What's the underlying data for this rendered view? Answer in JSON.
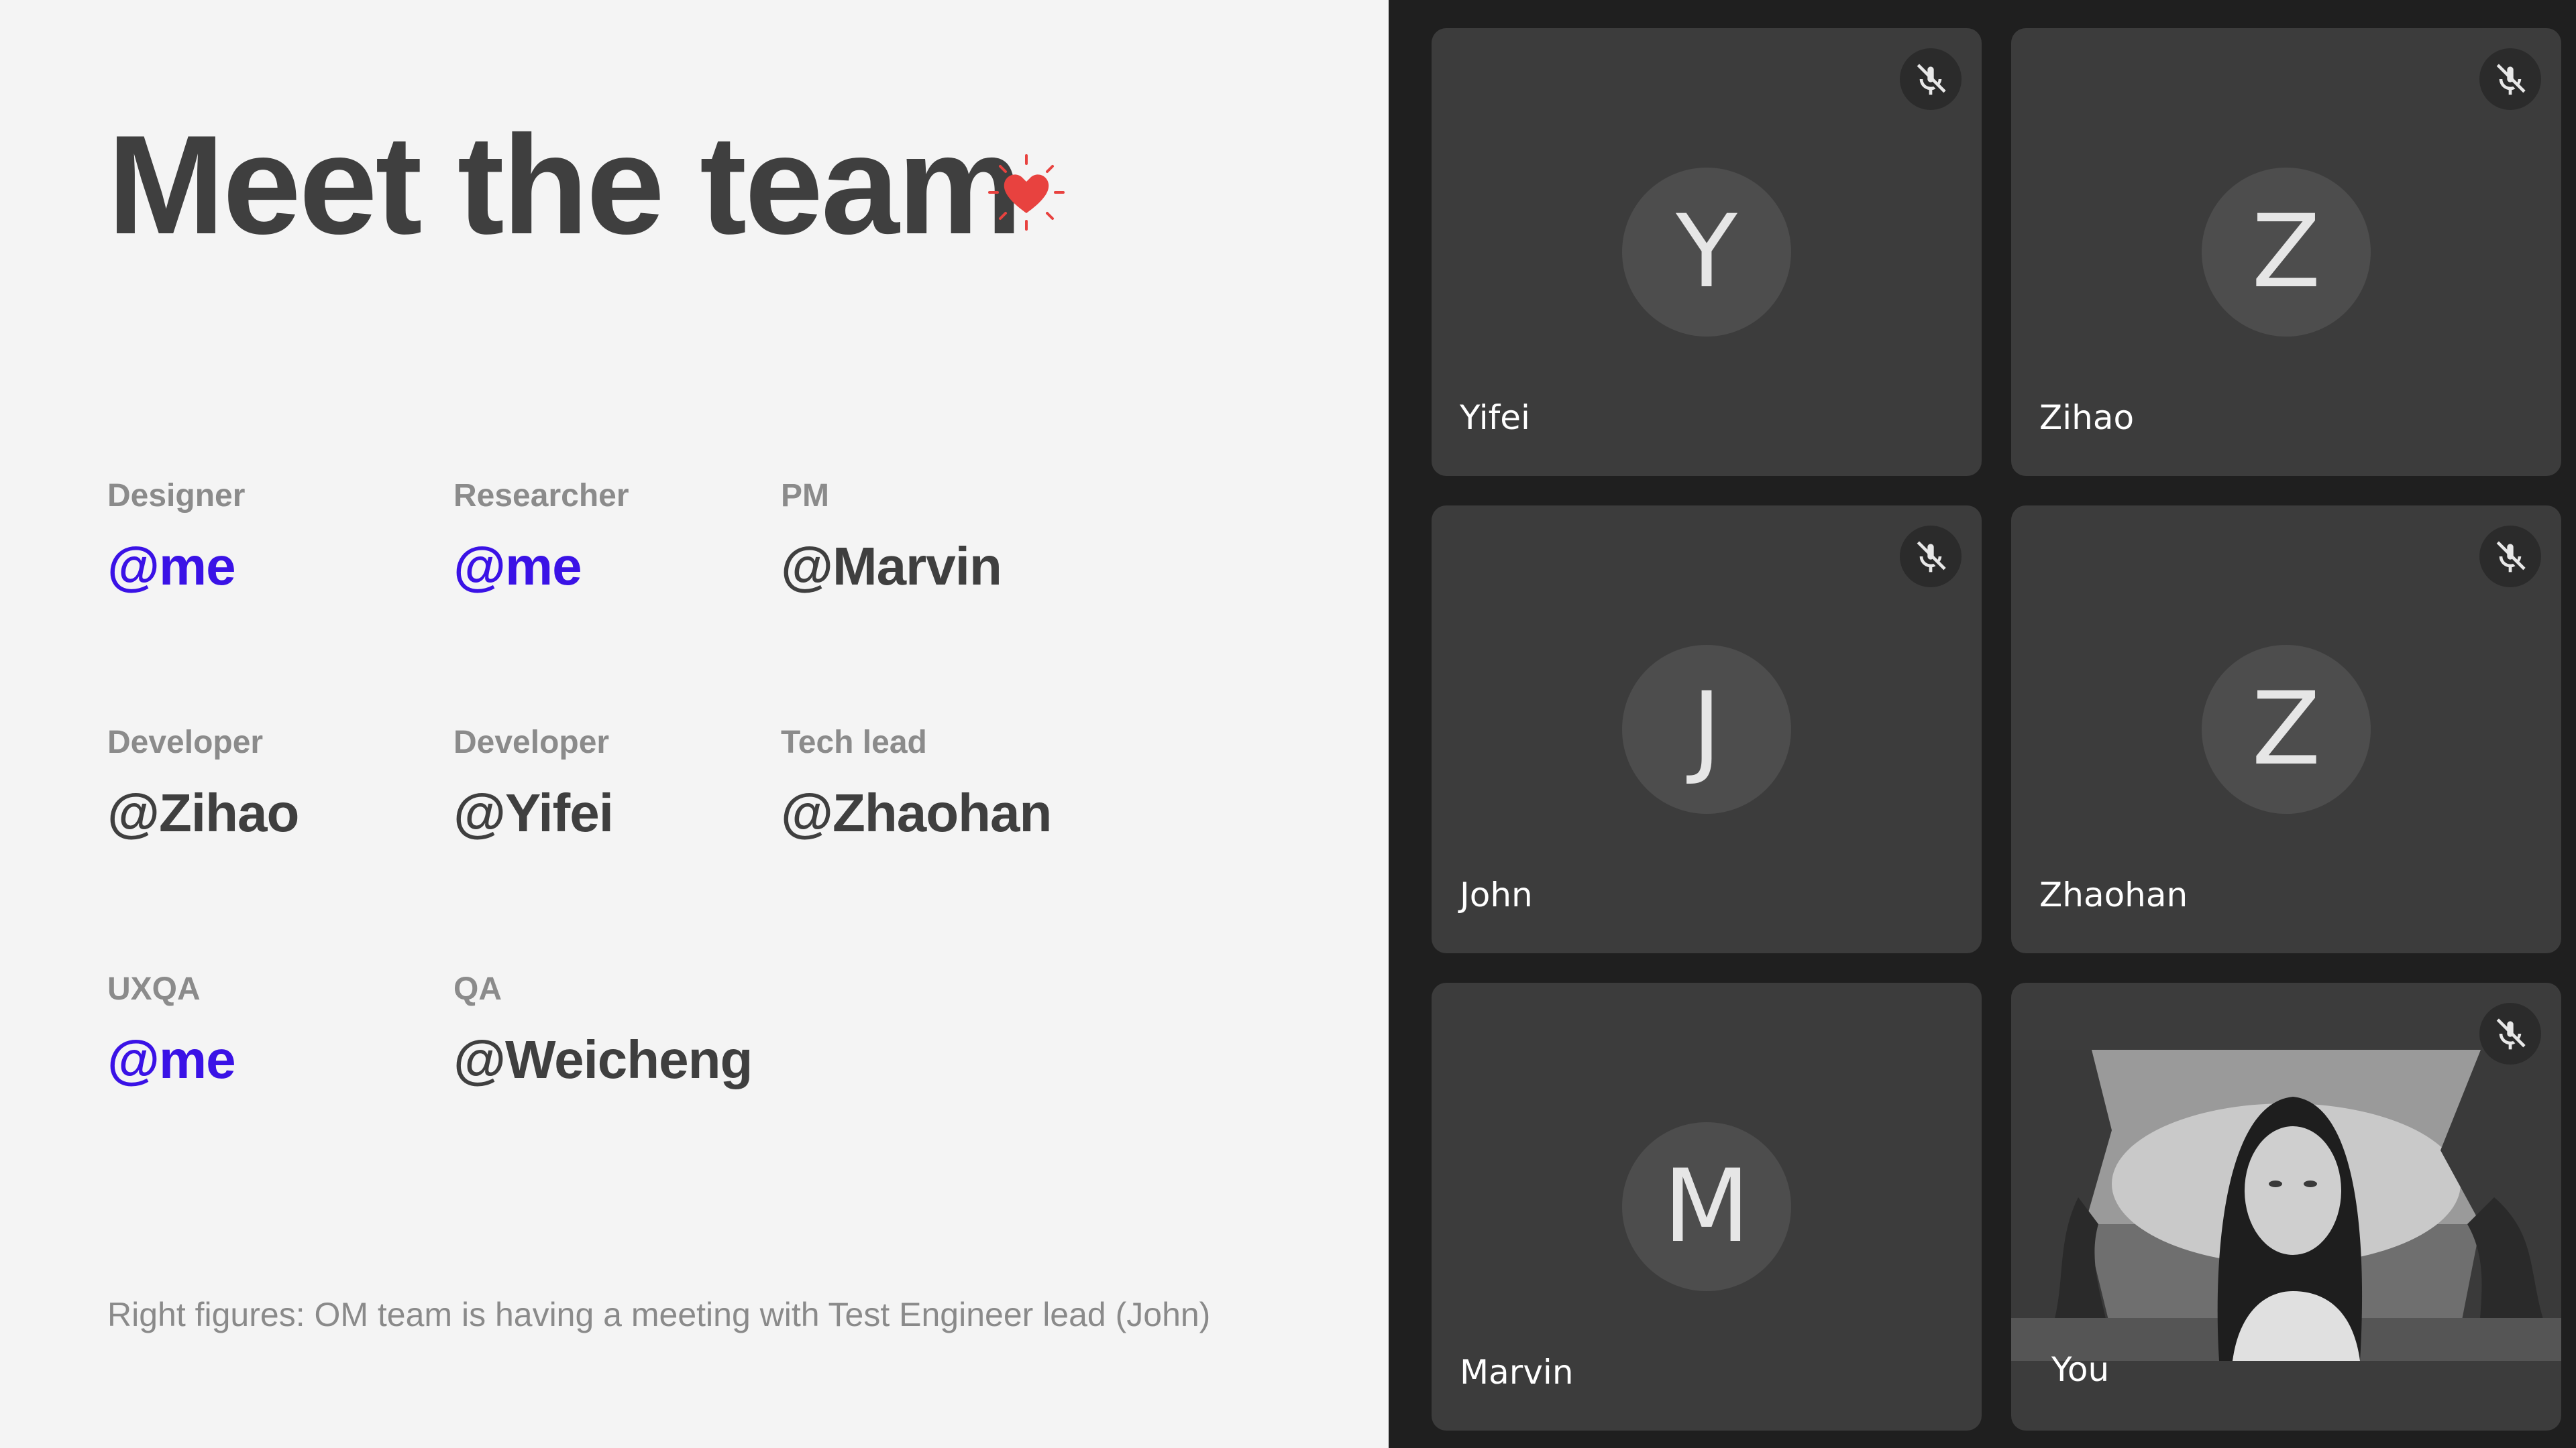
{
  "slide": {
    "title": "Meet the team",
    "team": [
      {
        "role": "Designer",
        "handle": "@me",
        "highlight": true
      },
      {
        "role": "Researcher",
        "handle": "@me",
        "highlight": true
      },
      {
        "role": "PM",
        "handle": "@Marvin",
        "highlight": false
      },
      {
        "role": "Developer",
        "handle": "@Zihao",
        "highlight": false
      },
      {
        "role": "Developer",
        "handle": "@Yifei",
        "highlight": false
      },
      {
        "role": "Tech lead",
        "handle": "@Zhaohan",
        "highlight": false
      },
      {
        "role": "UXQA",
        "handle": "@me",
        "highlight": true
      },
      {
        "role": "QA",
        "handle": "@Weicheng",
        "highlight": false
      }
    ],
    "caption": "Right figures: OM team is having a meeting with Test Engineer lead (John)",
    "colors": {
      "highlight": "#3a12e6",
      "text": "#3f3f3f",
      "muted": "#8b8b8b",
      "heart": "#e8423f"
    }
  },
  "meeting": {
    "participants": [
      {
        "name": "Yifei",
        "initial": "Y",
        "muted": true
      },
      {
        "name": "Zihao",
        "initial": "Z",
        "muted": true
      },
      {
        "name": "John",
        "initial": "J",
        "muted": true
      },
      {
        "name": "Zhaohan",
        "initial": "Z",
        "muted": true
      },
      {
        "name": "Marvin",
        "initial": "M",
        "muted": false
      },
      {
        "name": "You",
        "initial": "",
        "muted": true,
        "camera_on": true
      }
    ],
    "icons": {
      "mute": "mic-off-icon",
      "heart": "heart-icon"
    }
  }
}
